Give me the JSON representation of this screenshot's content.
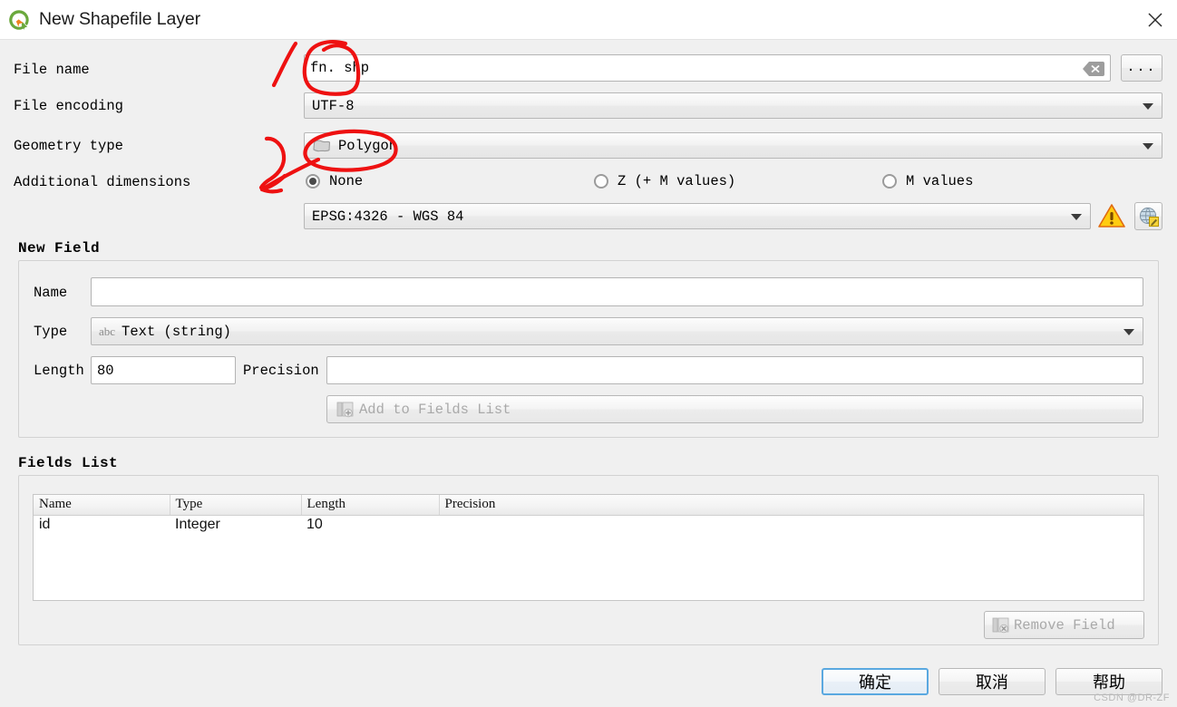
{
  "window": {
    "title": "New Shapefile Layer",
    "logo_icon": "qgis-logo-icon",
    "close_icon": "close-icon"
  },
  "form": {
    "file_name": {
      "label": "File name",
      "value": "fn. shp",
      "placeholder": "",
      "clear_icon": "clear-icon",
      "browse_label": "...",
      "browse_icon": "ellipsis-icon"
    },
    "file_encoding": {
      "label": "File encoding",
      "value": "UTF-8",
      "dropdown_icon": "chevron-down-icon"
    },
    "geometry_type": {
      "label": "Geometry type",
      "value": "Polygon",
      "value_icon": "polygon-icon",
      "dropdown_icon": "chevron-down-icon"
    },
    "additional_dimensions": {
      "label": "Additional dimensions",
      "options": [
        {
          "label": "None",
          "selected": true
        },
        {
          "label": "Z (+ M values)",
          "selected": false
        },
        {
          "label": "M values",
          "selected": false
        }
      ]
    },
    "crs": {
      "value": "EPSG:4326 - WGS 84",
      "dropdown_icon": "chevron-down-icon",
      "warning_icon": "warning-triangle-icon",
      "select_crs_icon": "globe-crs-icon"
    }
  },
  "new_field": {
    "group_title": "New Field",
    "name": {
      "label": "Name",
      "value": "",
      "placeholder": ""
    },
    "type": {
      "label": "Type",
      "value": "Text (string)",
      "value_icon": "abc-icon",
      "dropdown_icon": "chevron-down-icon"
    },
    "length": {
      "label": "Length",
      "value": "80"
    },
    "precision": {
      "label": "Precision",
      "value": "",
      "placeholder": ""
    },
    "add_button": {
      "label": "Add to Fields List",
      "icon": "add-field-icon",
      "disabled": true
    }
  },
  "fields_list": {
    "group_title": "Fields List",
    "columns": [
      "Name",
      "Type",
      "Length",
      "Precision"
    ],
    "rows": [
      {
        "name": "id",
        "type": "Integer",
        "length": "10",
        "precision": ""
      }
    ],
    "remove_button": {
      "label": "Remove Field",
      "icon": "remove-field-icon",
      "disabled": true
    }
  },
  "dialog_buttons": {
    "ok": "确定",
    "cancel": "取消",
    "help": "帮助"
  },
  "annotations": {
    "color": "#ee1111",
    "marks": [
      {
        "name": "circle-around-file-name",
        "target": "file_name"
      },
      {
        "name": "slash-stroke-left-of-file-name",
        "target": "file_name"
      },
      {
        "name": "circle-around-polygon",
        "target": "geometry_type"
      },
      {
        "name": "arrow-pointing-to-polygon",
        "target": "geometry_type"
      }
    ]
  },
  "watermark": {
    "text": "CSDN @DR-ZF"
  },
  "colors": {
    "window_bg": "#f0f0f0",
    "titlebar_bg": "#ffffff",
    "field_bg": "#ffffff",
    "border": "#b4b4b4",
    "accent_default_button": "#5aa8e0",
    "annotation_red": "#ee1111",
    "warning_yellow": "#ffcc00",
    "logo_green": "#5a9e3a",
    "logo_orange": "#e8821e"
  }
}
